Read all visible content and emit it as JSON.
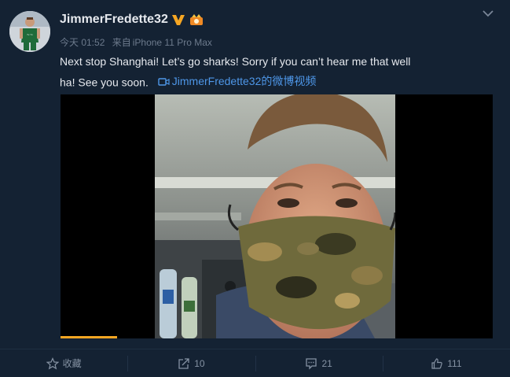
{
  "post": {
    "username": "JimmerFredette32",
    "timestamp": "今天 01:52",
    "source_prefix": "来自",
    "source": "iPhone 11 Pro Max",
    "text_line1": "Next stop Shanghai!  Let’s go sharks!  Sorry if you can’t hear me that well",
    "text_line2": "ha!  See you soon.",
    "video_link": "JimmerFredette32的微博视频",
    "icons": {
      "vip": "verified-v-icon",
      "badge": "member-badge-icon",
      "more": "chevron-down-icon",
      "video_link": "video-camera-icon"
    }
  },
  "video": {
    "progress": 0.13
  },
  "actions": {
    "favorite_label": "收藏",
    "repost_count": "10",
    "comment_count": "21",
    "like_count": "111"
  },
  "colors": {
    "background": "#142233",
    "link": "#4e97e8",
    "progress": "#f5a623",
    "verified": "#f5a623"
  }
}
